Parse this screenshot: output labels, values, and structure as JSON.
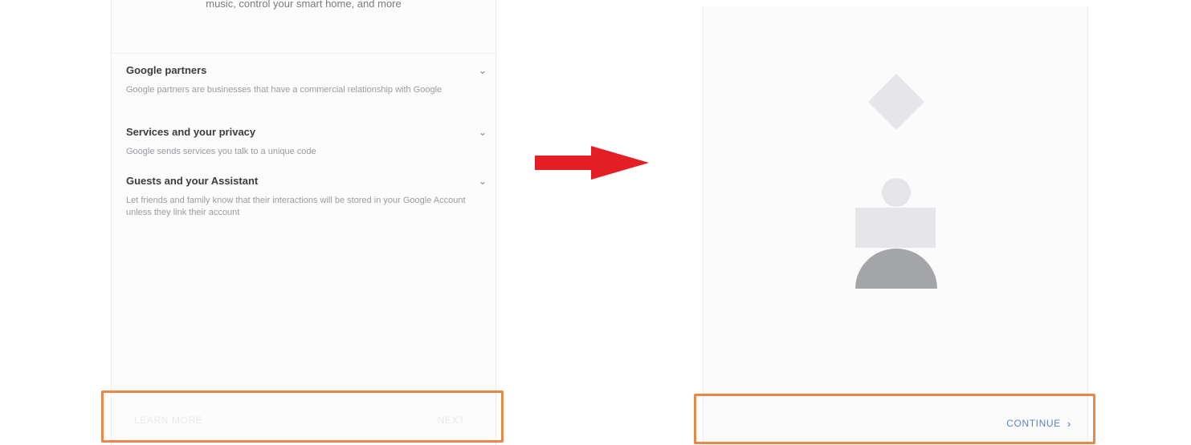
{
  "colors": {
    "arrow": "#e31e24",
    "highlight": "#e8874a",
    "continue": "#5a7fd6",
    "shape_light": "#e6e6ea",
    "shape_dark": "#a4a5a9"
  },
  "left_screen": {
    "top_text": "music, control your smart home, and more",
    "sections": [
      {
        "title": "Google partners",
        "description": "Google partners are businesses that have a commercial relationship with Google",
        "icon": "chevron-down-icon"
      },
      {
        "title": "Services and your privacy",
        "description": "Google sends services you talk to a unique code",
        "icon": "chevron-down-icon"
      },
      {
        "title": "Guests and your Assistant",
        "description": "Let friends and family know that their interactions will be stored in your Google Account unless they link their account",
        "icon": "chevron-down-icon"
      }
    ],
    "learn_more_label": "LEARN MORE",
    "next_label": "NEXT"
  },
  "right_screen": {
    "continue_label": "CONTINUE",
    "continue_icon": "chevron-right-icon"
  },
  "arrow_icon": "right-arrow-icon"
}
